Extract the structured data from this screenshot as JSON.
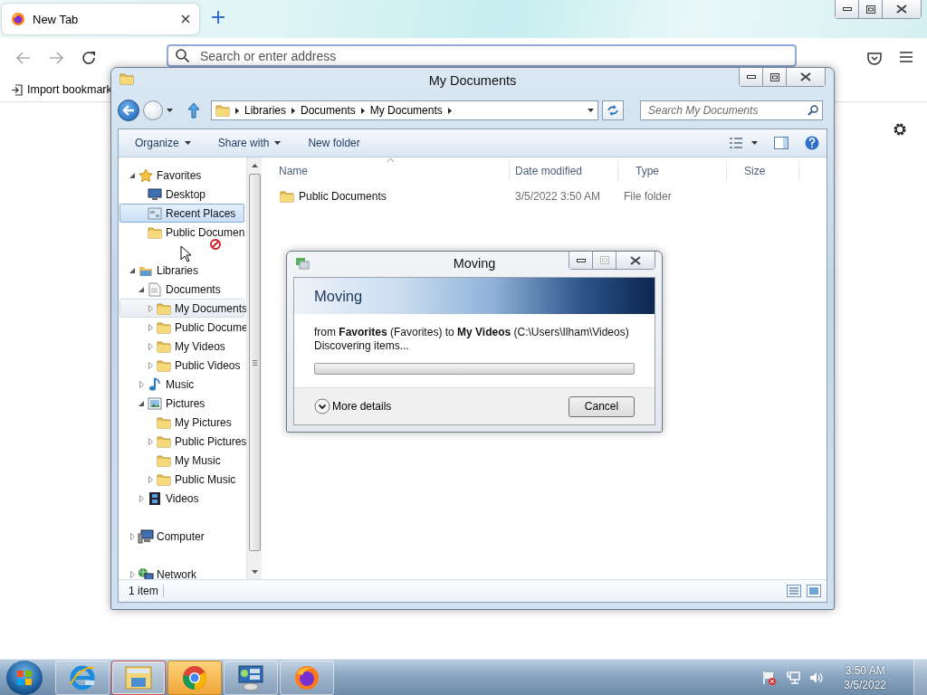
{
  "browser": {
    "tabs": [
      {
        "title": "New Tab",
        "selected": true
      }
    ],
    "address_bar": {
      "placeholder": "Search or enter address"
    },
    "bookmarks": [
      {
        "label": "Import bookmark"
      }
    ]
  },
  "explorer": {
    "title": "My Documents",
    "breadcrumb": [
      "Libraries",
      "Documents",
      "My Documents"
    ],
    "search": {
      "placeholder": "Search My Documents"
    },
    "toolbar": [
      {
        "label": "Organize",
        "dropdown": true
      },
      {
        "label": "Share with",
        "dropdown": true
      },
      {
        "label": "New folder",
        "dropdown": false
      }
    ],
    "nav_tree": [
      {
        "label": "Favorites",
        "kind": "star",
        "expandable": true,
        "expanded": true,
        "selected": false,
        "hovered": false,
        "children": [
          {
            "label": "Desktop",
            "kind": "monitor",
            "expandable": false,
            "selected": false,
            "hovered": false
          },
          {
            "label": "Recent Places",
            "kind": "recent",
            "expandable": false,
            "selected": true,
            "hovered": false
          },
          {
            "label": "Public Documen",
            "kind": "folder",
            "expandable": false,
            "selected": false,
            "hovered": false
          }
        ]
      },
      {
        "label": "Libraries",
        "kind": "library",
        "expandable": true,
        "expanded": true,
        "selected": false,
        "hovered": false,
        "children": [
          {
            "label": "Documents",
            "kind": "document",
            "expandable": true,
            "expanded": true,
            "selected": false,
            "hovered": false,
            "children": [
              {
                "label": "My Documents",
                "kind": "folder",
                "expandable": true,
                "expanded": false,
                "selected": false,
                "hovered": true
              },
              {
                "label": "Public Docume",
                "kind": "folder",
                "expandable": true,
                "expanded": false,
                "selected": false,
                "hovered": false
              },
              {
                "label": "My Videos",
                "kind": "folder",
                "expandable": true,
                "expanded": false,
                "selected": false,
                "hovered": false
              },
              {
                "label": "Public Videos",
                "kind": "folder",
                "expandable": true,
                "expanded": false,
                "selected": false,
                "hovered": false
              }
            ]
          },
          {
            "label": "Music",
            "kind": "music",
            "expandable": true,
            "expanded": false,
            "selected": false,
            "hovered": false
          },
          {
            "label": "Pictures",
            "kind": "picture",
            "expandable": true,
            "expanded": true,
            "selected": false,
            "hovered": false,
            "children": [
              {
                "label": "My Pictures",
                "kind": "folder",
                "expandable": false,
                "selected": false,
                "hovered": false
              },
              {
                "label": "Public Pictures",
                "kind": "folder",
                "expandable": true,
                "expanded": false,
                "selected": false,
                "hovered": false
              },
              {
                "label": "My Music",
                "kind": "folder",
                "expandable": false,
                "selected": false,
                "hovered": false
              },
              {
                "label": "Public Music",
                "kind": "folder",
                "expandable": true,
                "expanded": false,
                "selected": false,
                "hovered": false
              }
            ]
          },
          {
            "label": "Videos",
            "kind": "film",
            "expandable": true,
            "expanded": false,
            "selected": false,
            "hovered": false
          }
        ]
      },
      {
        "label": "Computer",
        "kind": "computer",
        "expandable": true,
        "expanded": false,
        "selected": false,
        "hovered": false
      },
      {
        "label": "Network",
        "kind": "network",
        "expandable": true,
        "expanded": false,
        "selected": false,
        "hovered": false
      }
    ],
    "columns": [
      "Name",
      "Date modified",
      "Type",
      "Size"
    ],
    "rows": [
      {
        "name": "Public Documents",
        "date_modified": "3/5/2022 3:50 AM",
        "type": "File folder"
      }
    ],
    "status_bar": "1 item"
  },
  "dialog": {
    "title": "Moving",
    "heading": "Moving",
    "message": "from **Favorites** (Favorites) to **My Videos** (C:\\Users\\Ilham\\Videos)",
    "status": "Discovering items...",
    "progress": {
      "level": 0
    },
    "details_button": "More details",
    "cancel_button": "Cancel"
  },
  "taskbar": {
    "apps": [
      {
        "kind": "ie",
        "open": false,
        "flashing": false
      },
      {
        "kind": "explorer",
        "open": true,
        "flashing": false
      },
      {
        "kind": "chrome",
        "open": false,
        "flashing": true
      },
      {
        "kind": "control-panel",
        "open": false,
        "flashing": false
      },
      {
        "kind": "firefox",
        "open": false,
        "flashing": false
      }
    ],
    "clock": {
      "time": "3:50 AM",
      "date": "3/5/2022"
    }
  }
}
